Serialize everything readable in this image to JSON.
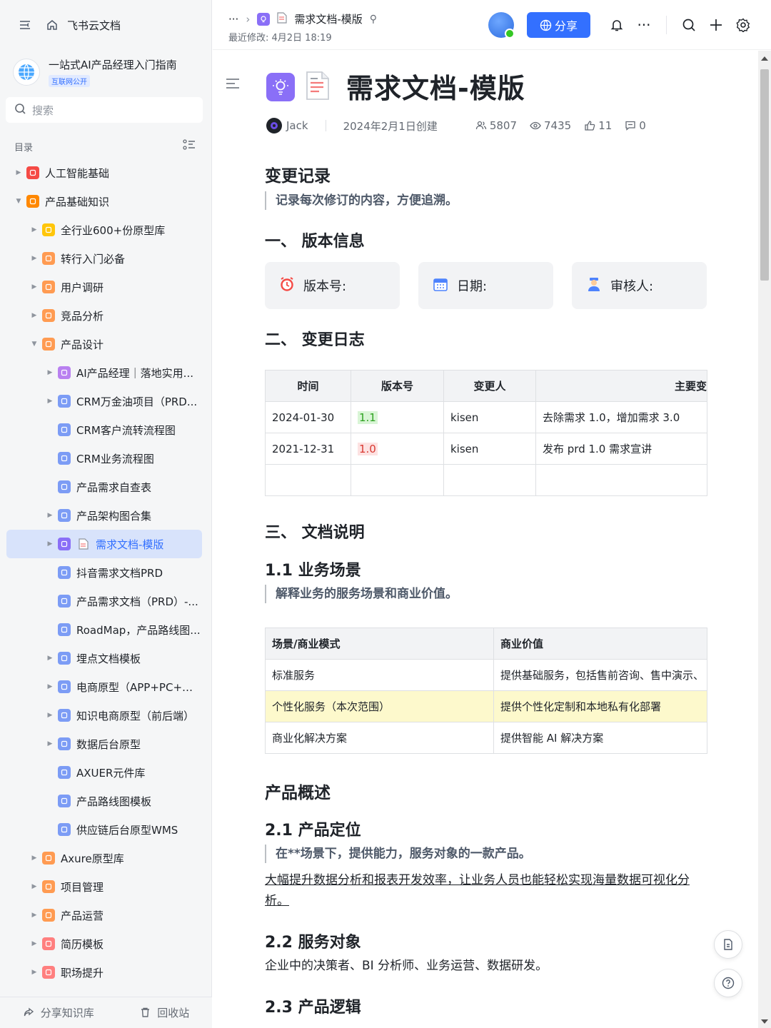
{
  "sidebar": {
    "title": "飞书云文档",
    "kb": {
      "name": "一站式AI产品经理入门指南",
      "badge": "互联网公开"
    },
    "search_placeholder": "搜索",
    "toc_label": "目录",
    "tree": [
      {
        "label": "人工智能基础",
        "level": 0,
        "caret": "right",
        "icon": "smile-emoji",
        "color": "#f54a45"
      },
      {
        "label": "产品基础知识",
        "level": 0,
        "caret": "down",
        "icon": "rainbow-emoji",
        "color": "#ff8800"
      },
      {
        "label": "全行业600+份原型库",
        "level": 1,
        "caret": "right",
        "icon": "flex-emoji",
        "color": "#ffc60a"
      },
      {
        "label": "转行入门必备",
        "level": 1,
        "caret": "right",
        "icon": "doc-icon",
        "color": "#ff9b52"
      },
      {
        "label": "用户调研",
        "level": 1,
        "caret": "right",
        "icon": "doc-icon",
        "color": "#ff9b52"
      },
      {
        "label": "竞品分析",
        "level": 1,
        "caret": "right",
        "icon": "doc-icon",
        "color": "#ff9b52"
      },
      {
        "label": "产品设计",
        "level": 1,
        "caret": "down",
        "icon": "doc-icon",
        "color": "#ff9b52"
      },
      {
        "label": "AI产品经理｜落地实用...",
        "level": 2,
        "caret": "right",
        "icon": "doc-icon",
        "color": "#b980f0"
      },
      {
        "label": "CRM万金油项目（PRD...",
        "level": 2,
        "caret": "right",
        "icon": "doc-icon",
        "color": "#7c9cf5"
      },
      {
        "label": "CRM客户流转流程图",
        "level": 2,
        "caret": "",
        "icon": "doc-icon",
        "color": "#7c9cf5"
      },
      {
        "label": "CRM业务流程图",
        "level": 2,
        "caret": "",
        "icon": "doc-icon",
        "color": "#7c9cf5"
      },
      {
        "label": "产品需求自查表",
        "level": 2,
        "caret": "",
        "icon": "doc-icon",
        "color": "#7c9cf5"
      },
      {
        "label": "产品架构图合集",
        "level": 2,
        "caret": "right",
        "icon": "doc-icon",
        "color": "#7c9cf5"
      },
      {
        "label": "需求文档-模版",
        "level": 2,
        "caret": "right",
        "icon": "bulb-icon",
        "color": "#8a6ff7",
        "active": true
      },
      {
        "label": "抖音需求文档PRD",
        "level": 2,
        "caret": "",
        "icon": "doc-icon",
        "color": "#7c9cf5"
      },
      {
        "label": "产品需求文档（PRD）-...",
        "level": 2,
        "caret": "",
        "icon": "doc-icon",
        "color": "#7c9cf5"
      },
      {
        "label": "RoadMap，产品路线图...",
        "level": 2,
        "caret": "",
        "icon": "doc-icon",
        "color": "#7c9cf5"
      },
      {
        "label": "埋点文档模板",
        "level": 2,
        "caret": "right",
        "icon": "doc-icon",
        "color": "#7c9cf5"
      },
      {
        "label": "电商原型（APP+PC+后...",
        "level": 2,
        "caret": "right",
        "icon": "doc-icon",
        "color": "#7c9cf5"
      },
      {
        "label": "知识电商原型（前后端）",
        "level": 2,
        "caret": "right",
        "icon": "doc-icon",
        "color": "#7c9cf5"
      },
      {
        "label": "数据后台原型",
        "level": 2,
        "caret": "right",
        "icon": "doc-icon",
        "color": "#7c9cf5"
      },
      {
        "label": "AXUER元件库",
        "level": 2,
        "caret": "",
        "icon": "doc-icon",
        "color": "#7c9cf5"
      },
      {
        "label": "产品路线图模板",
        "level": 2,
        "caret": "",
        "icon": "doc-icon",
        "color": "#7c9cf5"
      },
      {
        "label": "供应链后台原型WMS",
        "level": 2,
        "caret": "",
        "icon": "doc-icon",
        "color": "#7c9cf5"
      },
      {
        "label": "Axure原型库",
        "level": 1,
        "caret": "right",
        "icon": "doc-icon",
        "color": "#ff9b52"
      },
      {
        "label": "项目管理",
        "level": 1,
        "caret": "right",
        "icon": "doc-icon",
        "color": "#ff9b52"
      },
      {
        "label": "产品运营",
        "level": 1,
        "caret": "right",
        "icon": "doc-icon",
        "color": "#ff9b52"
      },
      {
        "label": "简历模板",
        "level": 1,
        "caret": "right",
        "icon": "doc-icon",
        "color": "#ff7f7f"
      },
      {
        "label": "职场提升",
        "level": 1,
        "caret": "right",
        "icon": "doc-icon",
        "color": "#ff7f7f"
      }
    ],
    "bottom": {
      "share": "分享知识库",
      "trash": "回收站"
    }
  },
  "header": {
    "ellipsis": "···",
    "doc_name": "需求文档-模版",
    "modified": "最近修改: 4月2日 18:19",
    "share_label": "分享",
    "more": "···"
  },
  "doc": {
    "title": "需求文档-模版",
    "author": "Jack",
    "created": "2024年2月1日创建",
    "stats": {
      "collaborators": "5807",
      "views": "7435",
      "likes": "11",
      "comments": "0"
    },
    "sections": {
      "change_record": "变更记录",
      "change_record_quote": "记录每次修订的内容，方便追溯。",
      "version_info": "一、 版本信息",
      "change_log": "二、 变更日志",
      "doc_desc": "三、 文档说明",
      "biz_scene": "1.1 业务场景",
      "biz_scene_quote": "解释业务的服务场景和商业价值。",
      "product_overview": "产品概述",
      "positioning": "2.1 产品定位",
      "positioning_quote": "在**场景下，提供能力，服务对象的一款产品。",
      "positioning_text": "大幅提升数据分析和报表开发效率，让业务人员也能轻松实现海量数据可视化分析。",
      "audience": "2.2 服务对象",
      "audience_text": "企业中的决策者、BI 分析师、业务运营、数据研发。",
      "logic": "2.3 产品逻辑"
    },
    "cards": {
      "version": "版本号:",
      "date": "日期:",
      "reviewer": "审核人:"
    },
    "changelog": {
      "headers": [
        "时间",
        "版本号",
        "变更人",
        "主要变"
      ],
      "rows": [
        [
          "2024-01-30",
          "1.1",
          "kisen",
          "去除需求 1.0，增加需求 3.0"
        ],
        [
          "2021-12-31",
          "1.0",
          "kisen",
          "发布 prd 1.0 需求宣讲"
        ]
      ]
    },
    "scene_table": {
      "headers": [
        "场景/商业模式",
        "商业价值"
      ],
      "rows": [
        [
          "标准服务",
          "提供基础服务，包括售前咨询、售中演示、"
        ],
        [
          "个性化服务（本次范围）",
          "提供个性化定制和本地私有化部署"
        ],
        [
          "商业化解决方案",
          "提供智能 AI 解决方案"
        ]
      ]
    }
  }
}
